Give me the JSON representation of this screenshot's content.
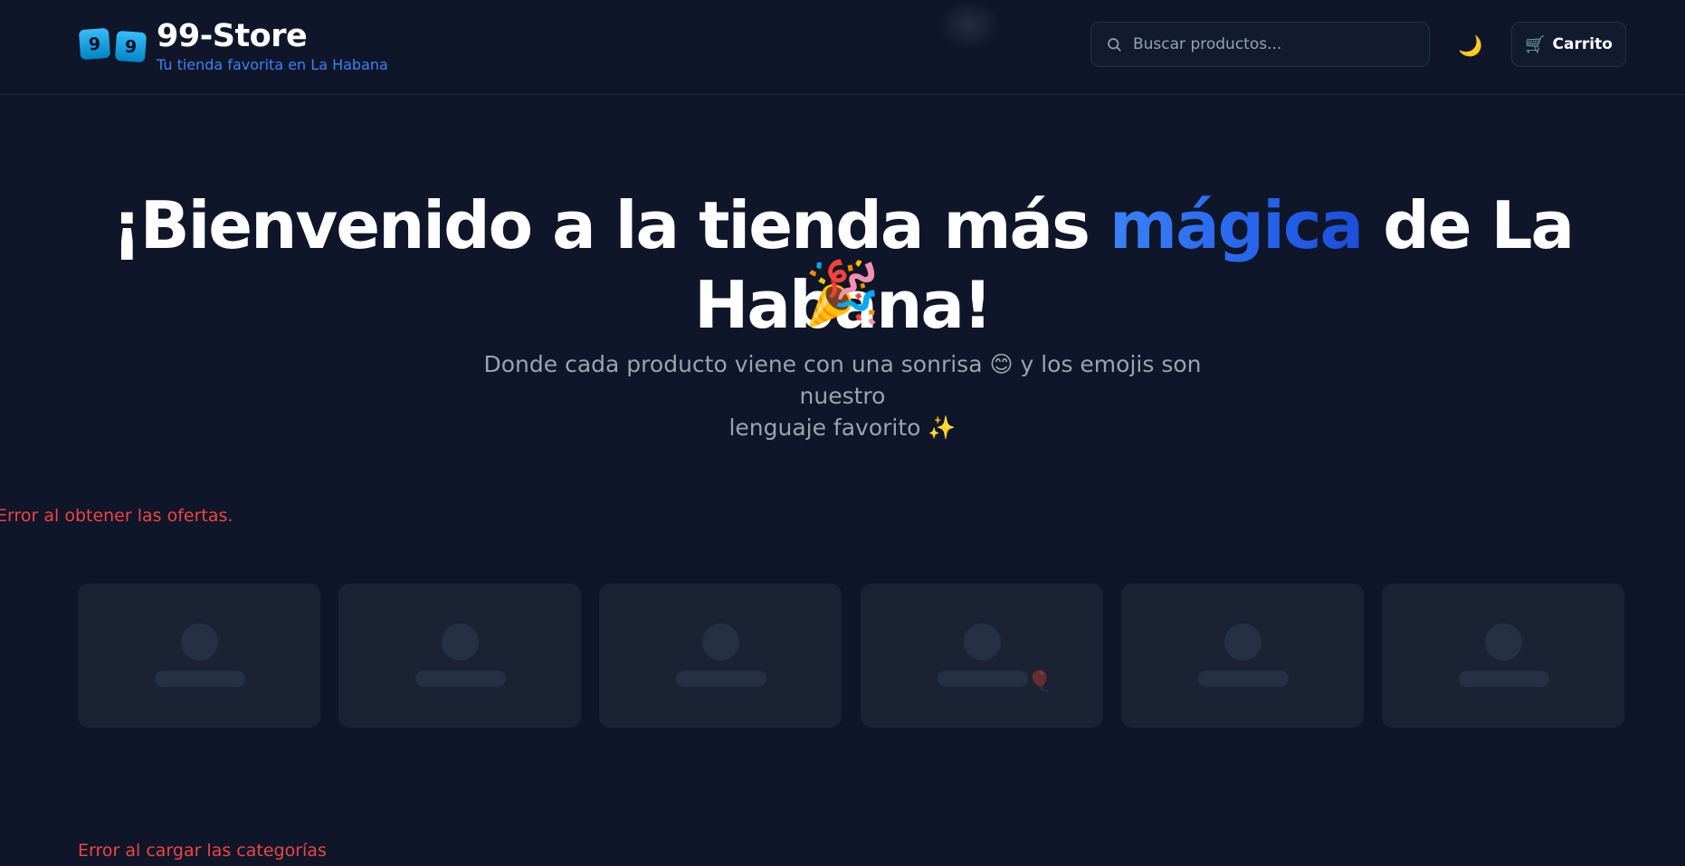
{
  "header": {
    "logo_dice": [
      "9",
      "9"
    ],
    "brand": "99-Store",
    "tagline": "Tu tienda favorita en La Habana",
    "search": {
      "placeholder": "Buscar productos...",
      "value": ""
    },
    "theme_toggle_icon": "🌙",
    "cart_icon": "🛒",
    "cart_label": "Carrito"
  },
  "hero": {
    "title_before": "¡Bienvenido a la tienda más ",
    "title_highlight": "mágica",
    "title_after": " de La Habana!",
    "title_emoji": "🎉",
    "subtitle_line1": "Donde cada producto viene con una sonrisa 😊 y los emojis son nuestro",
    "subtitle_line2": "lenguaje favorito ✨"
  },
  "offers": {
    "error": "Error al obtener las ofertas.",
    "skeleton_count": 6
  },
  "categories": {
    "error": "Error al cargar las categorías"
  },
  "colors": {
    "background": "#0f1629",
    "accent": "#3b82f6",
    "error": "#ef4444",
    "skeleton": "#1a2233"
  },
  "icons": {
    "search": "search-icon",
    "theme": "moon-icon",
    "cart": "cart-icon"
  }
}
